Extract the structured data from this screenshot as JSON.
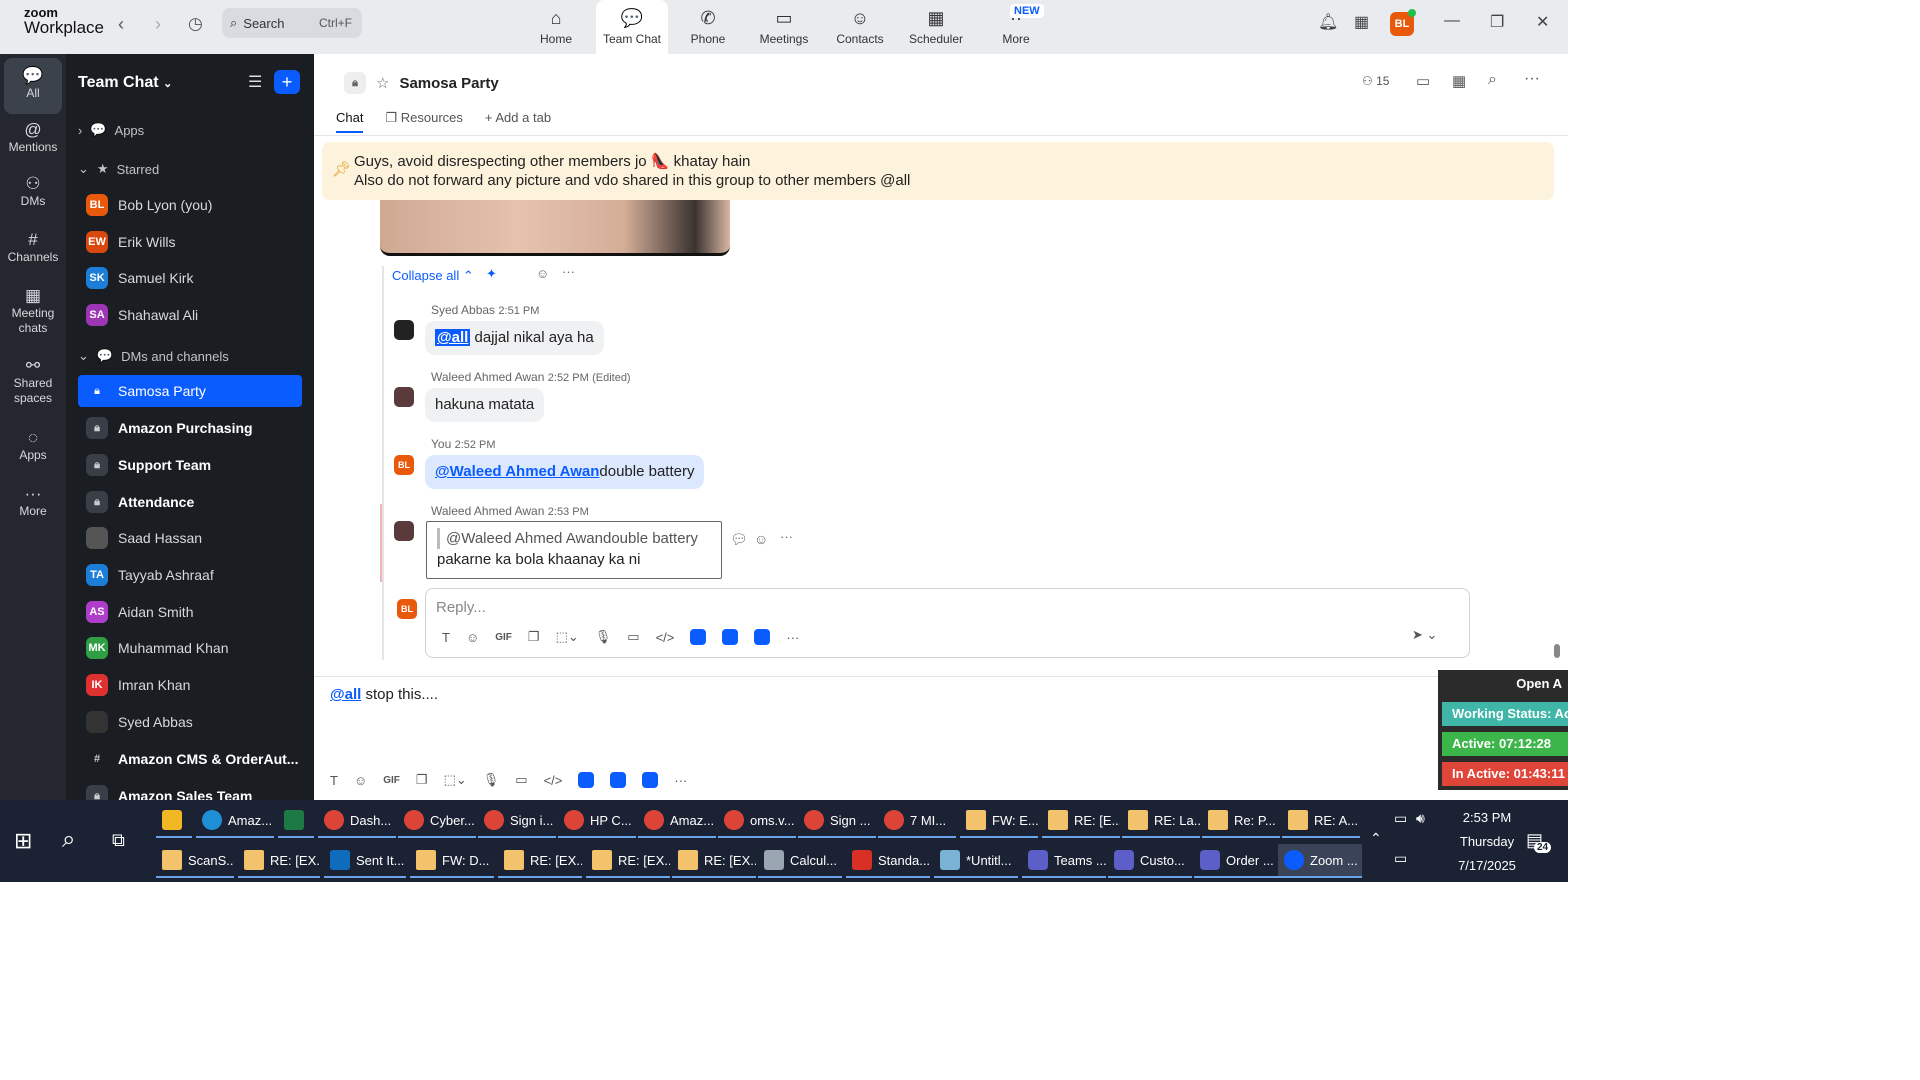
{
  "app": {
    "logo_line1": "zoom",
    "logo_line2": "Workplace"
  },
  "search": {
    "label": "Search",
    "shortcut": "Ctrl+F"
  },
  "nav": {
    "tabs": [
      {
        "label": "Home",
        "icon": "home-icon"
      },
      {
        "label": "Team Chat",
        "icon": "chat-icon"
      },
      {
        "label": "Phone",
        "icon": "phone-icon"
      },
      {
        "label": "Meetings",
        "icon": "video-icon"
      },
      {
        "label": "Contacts",
        "icon": "contacts-icon"
      },
      {
        "label": "Scheduler",
        "icon": "calendar-icon"
      },
      {
        "label": "More",
        "icon": "more-icon"
      }
    ],
    "new_badge": "NEW",
    "user_initials": "BL"
  },
  "rail": {
    "items": [
      {
        "label": "All"
      },
      {
        "label": "Mentions"
      },
      {
        "label": "DMs"
      },
      {
        "label": "Channels"
      },
      {
        "label": "Meeting chats"
      },
      {
        "label": "Shared spaces"
      },
      {
        "label": "Apps"
      },
      {
        "label": "More"
      }
    ]
  },
  "sidebar": {
    "title": "Team Chat",
    "apps_label": "Apps",
    "starred_label": "Starred",
    "starred": [
      {
        "initials": "BL",
        "name": "Bob Lyon (you)",
        "color": "#e8590c"
      },
      {
        "initials": "EW",
        "name": "Erik Wills",
        "color": "#d9480f"
      },
      {
        "initials": "SK",
        "name": "Samuel Kirk",
        "color": "#1c7ed6"
      },
      {
        "initials": "SA",
        "name": "Shahawal Ali",
        "color": "#9c36b5"
      }
    ],
    "dms_label": "DMs and channels",
    "dms": [
      {
        "name": "Samosa Party"
      },
      {
        "name": "Amazon Purchasing"
      },
      {
        "name": "Support Team"
      },
      {
        "name": "Attendance"
      },
      {
        "initials": "",
        "name": "Saad Hassan",
        "color": "#555555"
      },
      {
        "initials": "TA",
        "name": "Tayyab Ashraaf",
        "color": "#1c7ed6"
      },
      {
        "initials": "AS",
        "name": "Aidan Smith",
        "color": "#ae3ec9"
      },
      {
        "initials": "MK",
        "name": "Muhammad Khan",
        "color": "#2f9e44"
      },
      {
        "initials": "IK",
        "name": "Imran Khan",
        "color": "#e03131"
      },
      {
        "initials": "",
        "name": "Syed Abbas",
        "color": "#333333"
      },
      {
        "name": "Amazon CMS & OrderAut..."
      },
      {
        "name": "Amazon Sales Team"
      }
    ]
  },
  "channel": {
    "name": "Samosa Party",
    "member_count": "15",
    "tabs": [
      "Chat",
      "Resources",
      "Add a tab"
    ]
  },
  "pinned": {
    "line1": "Guys, avoid disrespecting other members jo 👠 khatay hain",
    "line2": "Also do not forward any picture and vdo shared in this group to other members @all"
  },
  "thread": {
    "collapse_label": "Collapse all",
    "messages": [
      {
        "sender": "Syed Abbas",
        "time": "2:51 PM",
        "mention": "@all",
        "text": " dajjal nikal aya ha"
      },
      {
        "sender": "Waleed Ahmed Awan",
        "time": "2:52 PM",
        "edited": "(Edited)",
        "text": "hakuna matata"
      },
      {
        "sender": "You",
        "time": "2:52 PM",
        "mention": "@Waleed Ahmed Awan",
        "text": "double battery",
        "initials": "BL"
      },
      {
        "sender": "Waleed Ahmed Awan",
        "time": "2:53 PM",
        "quote": "@Waleed Ahmed Awandouble battery",
        "text": "pakarne ka bola khaanay ka ni"
      }
    ],
    "reply_placeholder": "Reply...",
    "reply_initials": "BL"
  },
  "composer": {
    "mention": "@all",
    "text": " stop this...."
  },
  "overlay": {
    "open": "Open A",
    "status": "Working Status: Acti",
    "active": "Active: 07:12:28",
    "inactive": "In Active: 01:43:11"
  },
  "taskbar": {
    "row1": [
      "",
      "Amaz...",
      "",
      "Dash...",
      "Cyber...",
      "Sign i...",
      "HP C...",
      "Amaz...",
      "oms.v...",
      "Sign ...",
      "7 MI...",
      "FW: E...",
      "RE: [E...",
      "RE: La...",
      "Re: P...",
      "RE: A..."
    ],
    "row2": [
      "ScanS...",
      "RE: [EX...",
      "Sent It...",
      "FW: D...",
      "RE: [EX...",
      "RE: [EX...",
      "RE: [EX...",
      "Calcul...",
      "Standa...",
      "*Untitl...",
      "Teams ...",
      "Custo...",
      "Order ...",
      "Zoom ..."
    ],
    "time": "2:53 PM",
    "day": "Thursday",
    "date": "7/17/2025",
    "notifications": "24"
  }
}
